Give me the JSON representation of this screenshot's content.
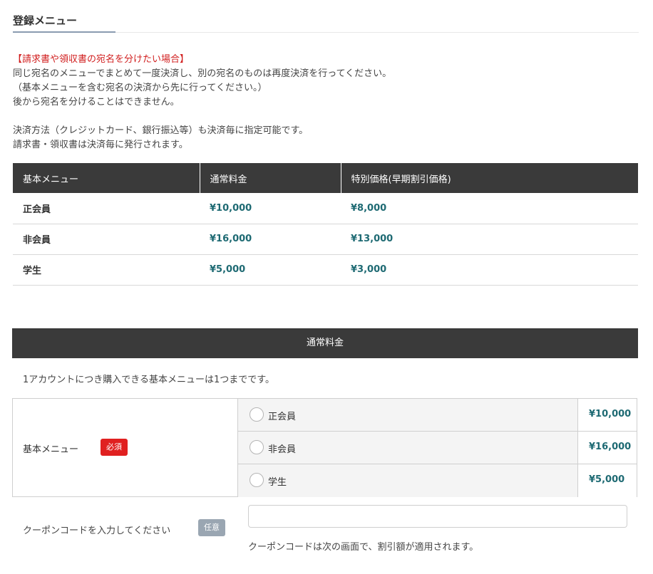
{
  "section": {
    "title": "登録メニュー"
  },
  "notice": {
    "warning": "【請求書や領収書の宛名を分けたい場合】",
    "lines": [
      "同じ宛名のメニューでまとめて一度決済し、別の宛名のものは再度決済を行ってください。",
      "（基本メニューを含む宛名の決済から先に行ってください。）",
      "後から宛名を分けることはできません。",
      "",
      "決済方法（クレジットカード、銀行振込等）も決済毎に指定可能です。",
      "請求書・領収書は決済毎に発行されます。"
    ]
  },
  "price_table": {
    "headers": [
      "基本メニュー",
      "通常料金",
      "特別価格(早期割引価格)"
    ],
    "rows": [
      {
        "name": "正会員",
        "regular": "¥10,000",
        "special": "¥8,000"
      },
      {
        "name": "非会員",
        "regular": "¥16,000",
        "special": "¥13,000"
      },
      {
        "name": "学生",
        "regular": "¥5,000",
        "special": "¥3,000"
      }
    ]
  },
  "band": {
    "title": "通常料金"
  },
  "limit_note": "1アカウントにつき購入できる基本メニューは1つまでです。",
  "form": {
    "menu_label": "基本メニュー",
    "required_badge": "必須",
    "options": [
      {
        "label": "正会員",
        "price": "¥10,000"
      },
      {
        "label": "非会員",
        "price": "¥16,000"
      },
      {
        "label": "学生",
        "price": "¥5,000"
      }
    ],
    "coupon_label": "クーポンコードを入力してください",
    "optional_badge": "任意",
    "coupon_value": "",
    "coupon_help": "クーポンコードは次の画面で、割引額が適用されます。"
  },
  "colors": {
    "accent_price": "#1e6a73",
    "header_bg": "#3a3a3a",
    "required": "#e02020",
    "optional": "#9aa6b2",
    "warning": "#d11f1f"
  }
}
